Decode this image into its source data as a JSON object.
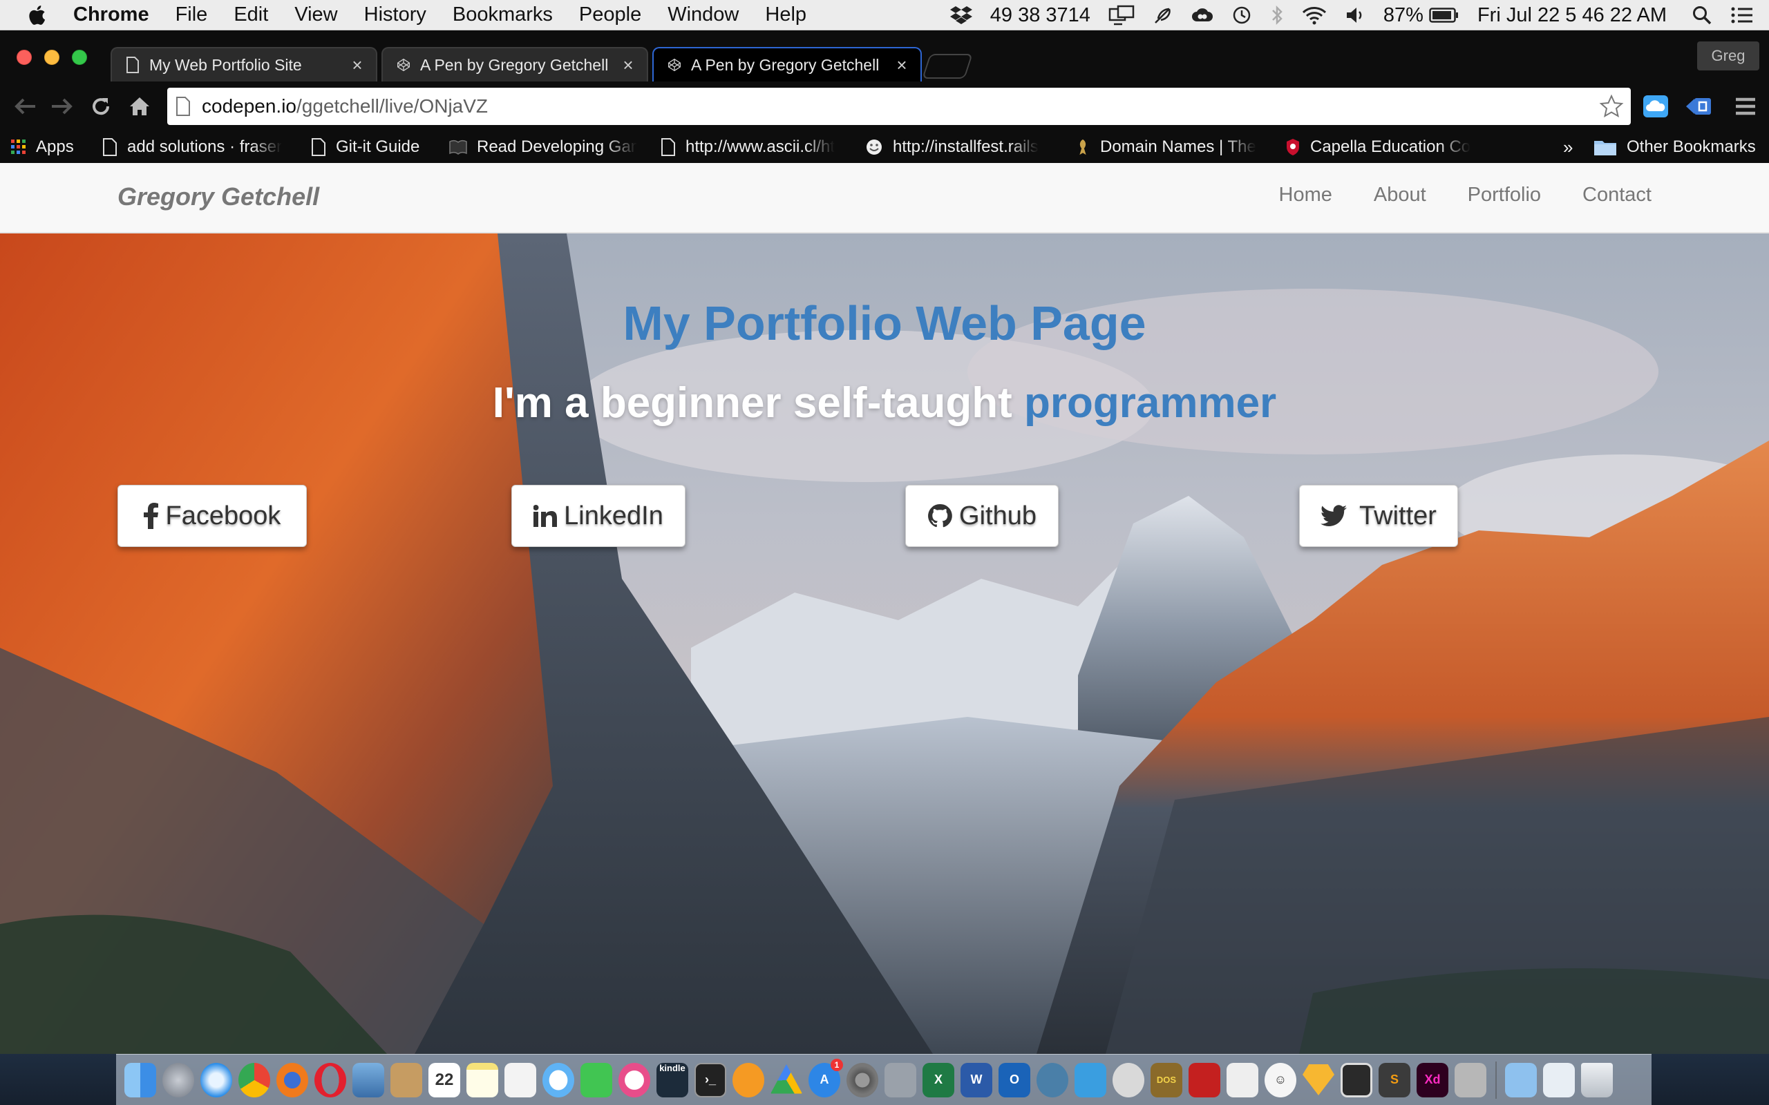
{
  "menubar": {
    "app": "Chrome",
    "items": [
      "File",
      "Edit",
      "View",
      "History",
      "Bookmarks",
      "People",
      "Window",
      "Help"
    ],
    "status": {
      "net_stats": "49 38 3714",
      "battery": "87%",
      "clock": "Fri Jul 22  5 46 22 AM"
    }
  },
  "browser": {
    "tabs": [
      {
        "title": "My Web Portfolio Site",
        "icon": "page-icon"
      },
      {
        "title": "A Pen by Gregory Getchell",
        "icon": "codepen-icon"
      },
      {
        "title": "A Pen by Gregory Getchell",
        "icon": "codepen-icon",
        "active": true
      }
    ],
    "profile": "Greg",
    "url_host": "codepen.io",
    "url_path": "/ggetchell/live/ONjaVZ",
    "bookmarks": [
      {
        "label": "Apps",
        "icon": "apps-grid-icon"
      },
      {
        "label": "add solutions · fraser",
        "icon": "page-icon"
      },
      {
        "label": "Git-it Guide",
        "icon": "page-icon"
      },
      {
        "label": "Read Developing Gam",
        "icon": "book-icon"
      },
      {
        "label": "http://www.ascii.cl/ht",
        "icon": "page-icon"
      },
      {
        "label": "http://installfest.rails",
        "icon": "smiley-icon"
      },
      {
        "label": "Domain Names | The",
        "icon": "domain-icon"
      },
      {
        "label": "Capella Education Co",
        "icon": "shield-icon"
      }
    ],
    "bookmarks_overflow": "»",
    "other_bookmarks": "Other Bookmarks"
  },
  "site": {
    "brand": "Gregory Getchell",
    "nav": [
      "Home",
      "About",
      "Portfolio",
      "Contact"
    ],
    "heading": "My Portfolio Web Page",
    "subheading_plain": "I'm a beginner self-taught ",
    "subheading_accent": "programmer",
    "buttons": [
      {
        "label": "Facebook",
        "icon": "facebook-icon"
      },
      {
        "label": "LinkedIn",
        "icon": "linkedin-icon"
      },
      {
        "label": "Github",
        "icon": "github-icon"
      },
      {
        "label": "Twitter",
        "icon": "twitter-icon"
      }
    ]
  },
  "colors": {
    "accent": "#3d7fc0",
    "nav_text": "#777777",
    "tab_active_border": "#2e66d3"
  },
  "dock": {
    "apps": [
      "finder",
      "launchpad",
      "safari",
      "chrome",
      "firefox",
      "opera",
      "preview",
      "contacts",
      "calendar",
      "notes",
      "photos",
      "messages",
      "facetime",
      "itunes",
      "kindle",
      "terminal",
      "ibooks",
      "drive",
      "app-store",
      "system-preferences",
      "utilities",
      "excel",
      "word",
      "outlook",
      "network",
      "screen-sharing",
      "game",
      "dosbox",
      "acrobat",
      "textedit",
      "smiley",
      "sketch",
      "editor",
      "sublime",
      "xd",
      "keychain",
      "downloads",
      "documents",
      "trash"
    ],
    "calendar_day": "22",
    "xd_label": "Xd",
    "kindle_label": "kindle",
    "app_store_badge": "1"
  }
}
